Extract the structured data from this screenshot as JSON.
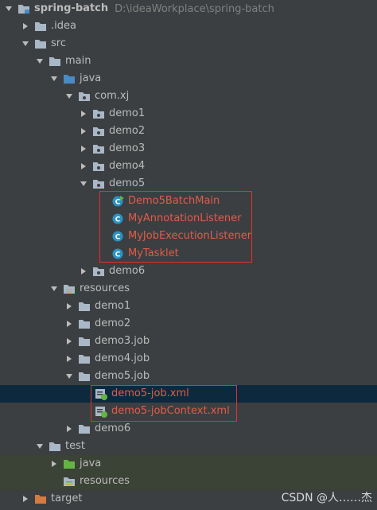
{
  "project": {
    "name": "spring-batch",
    "path": "D:\\ideaWorkplace\\spring-batch"
  },
  "tree": {
    "idea": ".idea",
    "src": "src",
    "main": "main",
    "java": "java",
    "com_xj": "com.xj",
    "demo1": "demo1",
    "demo2": "demo2",
    "demo3": "demo3",
    "demo4": "demo4",
    "demo5": "demo5",
    "demo5_files": [
      "Demo5BatchMain",
      "MyAnnotationListener",
      "MyJobExecutionListener",
      "MyTasklet"
    ],
    "demo6": "demo6",
    "resources": "resources",
    "res_demo1": "demo1",
    "res_demo2": "demo2",
    "res_demo3_job": "demo3.job",
    "res_demo4_job": "demo4.job",
    "res_demo5_job": "demo5.job",
    "demo5_job_files": [
      "demo5-job.xml",
      "demo5-jobContext.xml"
    ],
    "res_demo6": "demo6",
    "test": "test",
    "test_java": "java",
    "test_resources": "resources",
    "target": "target"
  },
  "colors": {
    "background": "#3c3f41",
    "text": "#bbbbbb",
    "modified_text": "#e05c49",
    "highlight_border": "#e0322b",
    "selection": "#0d293e",
    "folder": "#a9b7c6",
    "source_folder": "#4a8ac5",
    "test_folder": "#62b543",
    "excluded_folder": "#d47b3f",
    "class_icon": "#2b93c4"
  },
  "watermark": "CSDN @人……杰"
}
